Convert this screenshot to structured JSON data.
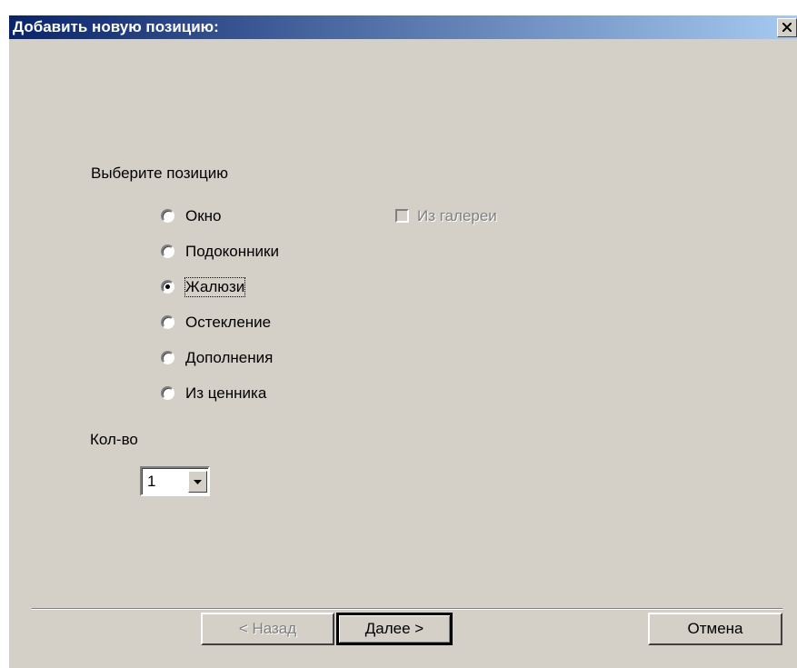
{
  "window": {
    "title": "Добавить новую позицию:"
  },
  "icons": {
    "close": "close-icon",
    "dropdown": "chevron-down-icon"
  },
  "prompt": "Выберите позицию",
  "positions": [
    {
      "label": "Окно",
      "selected": false
    },
    {
      "label": "Подоконники",
      "selected": false
    },
    {
      "label": "Жалюзи",
      "selected": true
    },
    {
      "label": "Остекление",
      "selected": false
    },
    {
      "label": "Дополнения",
      "selected": false
    },
    {
      "label": "Из ценника",
      "selected": false
    }
  ],
  "gallery_checkbox": {
    "label": "Из галереи",
    "checked": false,
    "enabled": false
  },
  "quantity": {
    "label": "Кол-во",
    "value": "1"
  },
  "buttons": {
    "back": "< Назад",
    "next": "Далее >",
    "cancel": "Отмена"
  }
}
